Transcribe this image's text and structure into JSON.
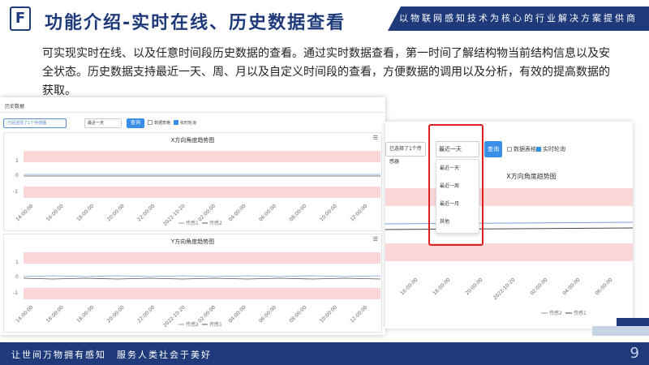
{
  "header": {
    "logo": "F",
    "title": "功能介绍-实时在线、历史数据查看",
    "banner": "以物联网感知技术为核心的行业解决方案提供商"
  },
  "intro": "可实现实时在线、以及任意时间段历史数据的查看。通过实时数据查看，第一时间了解结构物当前结构信息以及安全状态。历史数据支持最近一天、周、月以及自定义时间段的查看，方便数据的调用以及分析，有效的提高数据的获取。",
  "screen1": {
    "title": "历史数据",
    "sensor_input": "已经选择了1个传感器",
    "period_select": "最近一天",
    "query_button": "查询",
    "check_table": "数据表格",
    "check_realtime": "实时轮询",
    "charts": [
      {
        "title": "X方向角度趋势图",
        "legend": [
          "传感1",
          "传感2"
        ]
      },
      {
        "title": "Y方向角度趋势图",
        "legend": [
          "传感2",
          "传感1"
        ]
      }
    ],
    "x_ticks": [
      "14:00:00",
      "16:00:00",
      "18:00:00",
      "20:00:00",
      "22:00:00",
      "2022-10-20",
      "02:00:00",
      "04:00:00",
      "06:00:00",
      "08:00:00",
      "10:00:00",
      "12:00:00"
    ],
    "y_ticks_x": [
      "1",
      "0",
      "-1"
    ],
    "y_ticks_y": [
      "1",
      "0",
      "-1"
    ]
  },
  "screen2": {
    "sensor_input": "已选择了1个传感器",
    "period_select": "最近一天",
    "query_button": "查询",
    "check_table": "数据表格",
    "check_realtime": "实时轮询",
    "chart_title": "X方向角度趋势图",
    "dropdown": [
      "最近一天",
      "最近一周",
      "最近一月",
      "其他"
    ],
    "x_ticks": [
      "16:00:00",
      "18:00:00",
      "20:00:00",
      "2022-10-20",
      "02:00:00",
      "04:00:00",
      "06:00:00"
    ],
    "legend": [
      "传感2",
      "传感1"
    ]
  },
  "footer": {
    "slogan": "让世间万物拥有感知　服务人类社会于美好",
    "page": "9"
  }
}
